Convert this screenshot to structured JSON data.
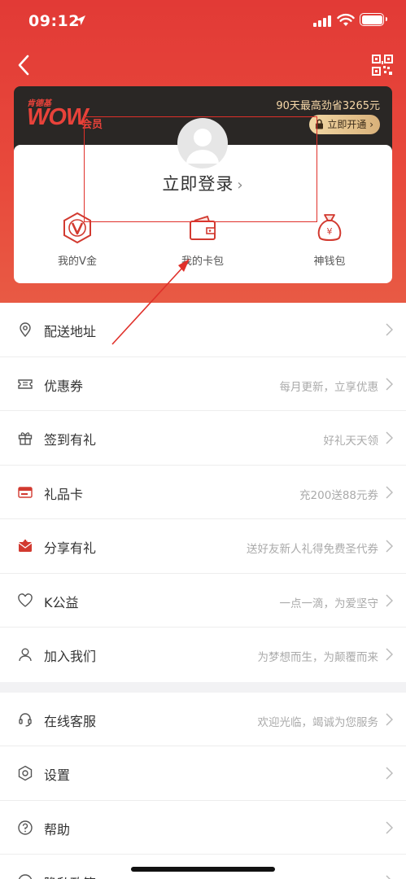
{
  "status_bar": {
    "time": "09:12"
  },
  "member": {
    "brand_small": "肯德基",
    "logo": "WOW",
    "logo_sub": "会员",
    "promo": "90天最高劲省3265元",
    "open_label": "立即开通 ›"
  },
  "login": {
    "label": "立即登录",
    "arrow": "›"
  },
  "entries": [
    {
      "label": "我的V金",
      "icon": "v-coin-icon"
    },
    {
      "label": "我的卡包",
      "icon": "wallet-icon"
    },
    {
      "label": "神钱包",
      "icon": "money-bag-icon"
    }
  ],
  "menu": {
    "group1": [
      {
        "label": "配送地址",
        "sub": "",
        "icon": "location-pin-icon"
      },
      {
        "label": "优惠券",
        "sub": "每月更新，立享优惠",
        "icon": "coupon-icon"
      },
      {
        "label": "签到有礼",
        "sub": "好礼天天领",
        "icon": "gift-icon"
      },
      {
        "label": "礼品卡",
        "sub": "充200送88元券",
        "icon": "gift-card-icon"
      },
      {
        "label": "分享有礼",
        "sub": "送好友新人礼得免费圣代券",
        "icon": "share-envelope-icon"
      },
      {
        "label": "K公益",
        "sub": "一点一滴，为爱坚守",
        "icon": "heart-icon"
      },
      {
        "label": "加入我们",
        "sub": "为梦想而生，为颠覆而来",
        "icon": "person-icon"
      }
    ],
    "group2": [
      {
        "label": "在线客服",
        "sub": "欢迎光临，竭诚为您服务",
        "icon": "headset-icon"
      },
      {
        "label": "设置",
        "sub": "",
        "icon": "settings-icon"
      },
      {
        "label": "帮助",
        "sub": "",
        "icon": "help-icon"
      },
      {
        "label": "隐私政策",
        "sub": "",
        "icon": "privacy-icon"
      }
    ]
  },
  "colors": {
    "primary_red": "#e23a36",
    "gold": "#f1d7a4",
    "banner_dark": "#2a2725"
  }
}
